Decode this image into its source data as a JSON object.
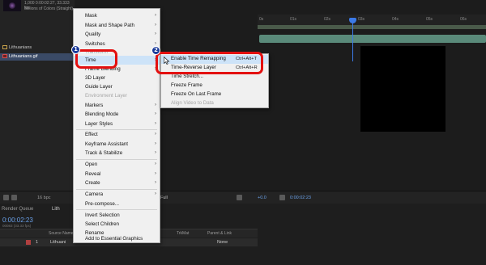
{
  "project": {
    "meta_line1": "1,000 0:00:02:27, 33.333 fps",
    "meta_line2": "Millions of Colors (Straight)",
    "items": [
      {
        "label": "Lithuanians"
      },
      {
        "label": "Lithuanians.gif"
      }
    ]
  },
  "context_menu": {
    "items": [
      {
        "label": "Mask",
        "arrow": "›"
      },
      {
        "label": "Mask and Shape Path",
        "arrow": "›"
      },
      {
        "label": "Quality",
        "arrow": "›"
      },
      {
        "label": "Switches",
        "arrow": "›"
      },
      {
        "label": "Transform",
        "arrow": "›"
      },
      {
        "label": "Time",
        "arrow": "›"
      },
      {
        "label": "Frame Blending",
        "arrow": "›"
      },
      {
        "label": "3D Layer",
        "arrow": ""
      },
      {
        "label": "Guide Layer",
        "arrow": ""
      },
      {
        "label": "Environment Layer",
        "arrow": ""
      },
      {
        "label": "Markers",
        "arrow": "›"
      },
      {
        "label": "Blending Mode",
        "arrow": "›"
      },
      {
        "label": "Layer Styles",
        "arrow": "›"
      },
      {
        "label": "Effect",
        "arrow": "›"
      },
      {
        "label": "Keyframe Assistant",
        "arrow": "›"
      },
      {
        "label": "Track & Stabilize",
        "arrow": "›"
      },
      {
        "label": "Open",
        "arrow": "›"
      },
      {
        "label": "Reveal",
        "arrow": "›"
      },
      {
        "label": "Create",
        "arrow": "›"
      },
      {
        "label": "Camera",
        "arrow": "›"
      },
      {
        "label": "Pre-compose...",
        "arrow": ""
      },
      {
        "label": "Invert Selection",
        "arrow": ""
      },
      {
        "label": "Select Children",
        "arrow": ""
      },
      {
        "label": "Rename",
        "arrow": ""
      },
      {
        "label": "Add to Essential Graphics",
        "arrow": ""
      }
    ]
  },
  "time_submenu": {
    "items": [
      {
        "label": "Enable Time Remapping",
        "shortcut": "Ctrl+Alt+T"
      },
      {
        "label": "Time-Reverse Layer",
        "shortcut": "Ctrl+Alt+R"
      },
      {
        "label": "Time Stretch...",
        "shortcut": ""
      },
      {
        "label": "Freeze Frame",
        "shortcut": ""
      },
      {
        "label": "Freeze On Last Frame",
        "shortcut": ""
      },
      {
        "label": "Align Video to Data",
        "shortcut": ""
      }
    ]
  },
  "annotations": {
    "badge1": "1",
    "badge2": "2"
  },
  "viewer_bar": {
    "bit_depth": "16 bpc",
    "zoom": "Full",
    "exposure": "+0.0",
    "timecode": "0:00:02:23"
  },
  "timeline": {
    "tab_render_queue": "Render Queue",
    "tab_comp": "Lith",
    "current_time": "0:00:02:23",
    "frames": "00083 (33.33 fps)",
    "columns": {
      "source_name": "Source Name",
      "trkmat": "TrkMat",
      "parent": "Parent & Link"
    },
    "layer": {
      "number": "1",
      "name": "Lithuani",
      "parent": "None"
    },
    "ruler_ticks": [
      "0s",
      "01s",
      "02s",
      "03s",
      "04s",
      "05s",
      "06s"
    ]
  },
  "colors": {
    "highlight_red": "#e31010",
    "badge_blue": "#1a3a9a",
    "menu_bg": "#f0f0f0",
    "menu_hover": "#cde3f8",
    "timecode_blue": "#6aa0e8"
  }
}
